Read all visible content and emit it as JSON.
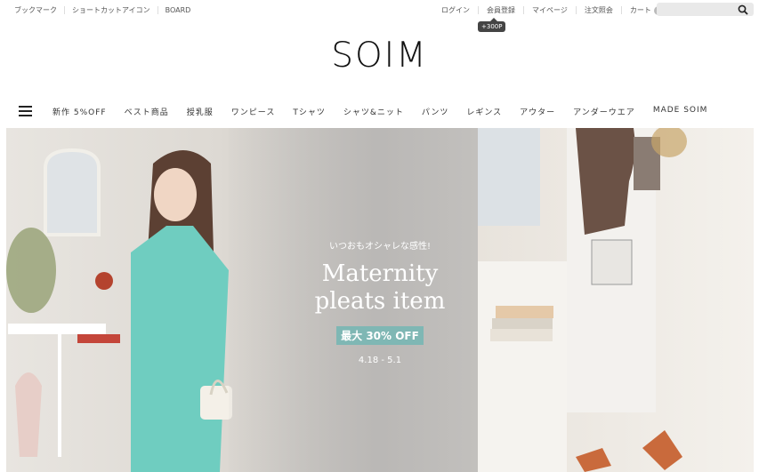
{
  "util_nav": {
    "left_links": [
      "ブックマーク",
      "ショートカットアイコン",
      "BOARD"
    ],
    "login": "ログイン",
    "register": "会員登録",
    "mypage": "マイページ",
    "orders": "注文照会",
    "cart": "カート",
    "cart_count": "0"
  },
  "tooltip": "+300P",
  "brand": {
    "logo": "SOIM"
  },
  "nav": {
    "items": [
      "新作 5%OFF",
      "ベスト商品",
      "授乳服",
      "ワンピース",
      "Tシャツ",
      "シャツ&ニット",
      "パンツ",
      "レギンス",
      "アウター",
      "アンダーウエア",
      "MADE SOIM"
    ]
  },
  "hero": {
    "subtitle": "いつおもオシャレな感性!",
    "title_line1": "Maternity",
    "title_line2": "pleats item",
    "badge": "最大 30% OFF",
    "date": "4.18 - 5.1",
    "colors": {
      "badge": "#7fb7b4",
      "dress_left": "#6fcdc0",
      "dress_right": "#f3f1ee"
    }
  }
}
